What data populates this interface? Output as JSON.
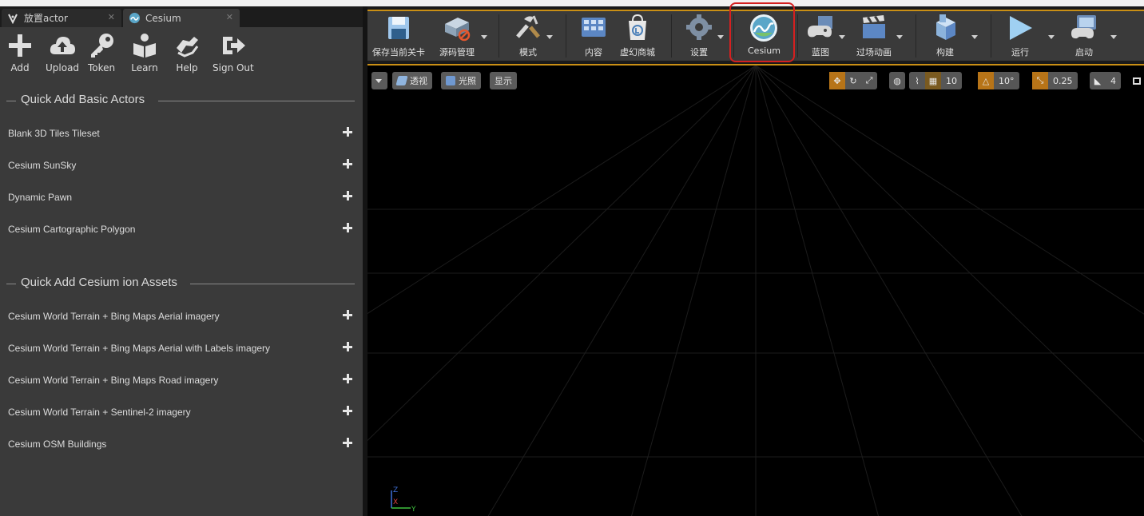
{
  "left_panel": {
    "tabs": [
      {
        "label": "放置actor",
        "icon": "place-actor-icon"
      },
      {
        "label": "Cesium",
        "icon": "cesium-icon"
      }
    ],
    "toolbar": [
      {
        "label": "Add",
        "icon": "plus-icon"
      },
      {
        "label": "Upload",
        "icon": "cloud-upload-icon"
      },
      {
        "label": "Token",
        "icon": "key-icon"
      },
      {
        "label": "Learn",
        "icon": "book-reader-icon"
      },
      {
        "label": "Help",
        "icon": "hands-help-icon"
      },
      {
        "label": "Sign Out",
        "icon": "sign-out-icon"
      }
    ],
    "sections": [
      {
        "title": "Quick Add Basic Actors",
        "items": [
          "Blank 3D Tiles Tileset",
          "Cesium SunSky",
          "Dynamic Pawn",
          "Cesium Cartographic Polygon"
        ]
      },
      {
        "title": "Quick Add Cesium ion Assets",
        "items": [
          "Cesium World Terrain + Bing Maps Aerial imagery",
          "Cesium World Terrain + Bing Maps Aerial with Labels imagery",
          "Cesium World Terrain + Bing Maps Road imagery",
          "Cesium World Terrain + Sentinel-2 imagery",
          "Cesium OSM Buildings"
        ]
      }
    ]
  },
  "main_toolbar": {
    "buttons": [
      {
        "label": "保存当前关卡",
        "icon": "save-icon"
      },
      {
        "label": "源码管理",
        "icon": "source-control-icon"
      },
      {
        "label": "模式",
        "icon": "modes-icon"
      },
      {
        "label": "内容",
        "icon": "content-icon"
      },
      {
        "label": "虚幻商城",
        "icon": "marketplace-icon"
      },
      {
        "label": "设置",
        "icon": "settings-icon"
      },
      {
        "label": "Cesium",
        "icon": "cesium-icon"
      },
      {
        "label": "蓝图",
        "icon": "blueprint-icon"
      },
      {
        "label": "过场动画",
        "icon": "cinematics-icon"
      },
      {
        "label": "构建",
        "icon": "build-icon"
      },
      {
        "label": "运行",
        "icon": "play-icon"
      },
      {
        "label": "启动",
        "icon": "launch-icon"
      }
    ],
    "highlight_color": "#d42020",
    "accent_color": "#c98f15"
  },
  "viewport": {
    "view_mode": "透视",
    "lighting": "光照",
    "show": "显示",
    "grid_snap": "10",
    "rotation_snap": "10°",
    "scale_snap": "0.25",
    "camera_speed": "4",
    "axis": {
      "z": "Z",
      "x": "X",
      "y": "Y"
    }
  }
}
